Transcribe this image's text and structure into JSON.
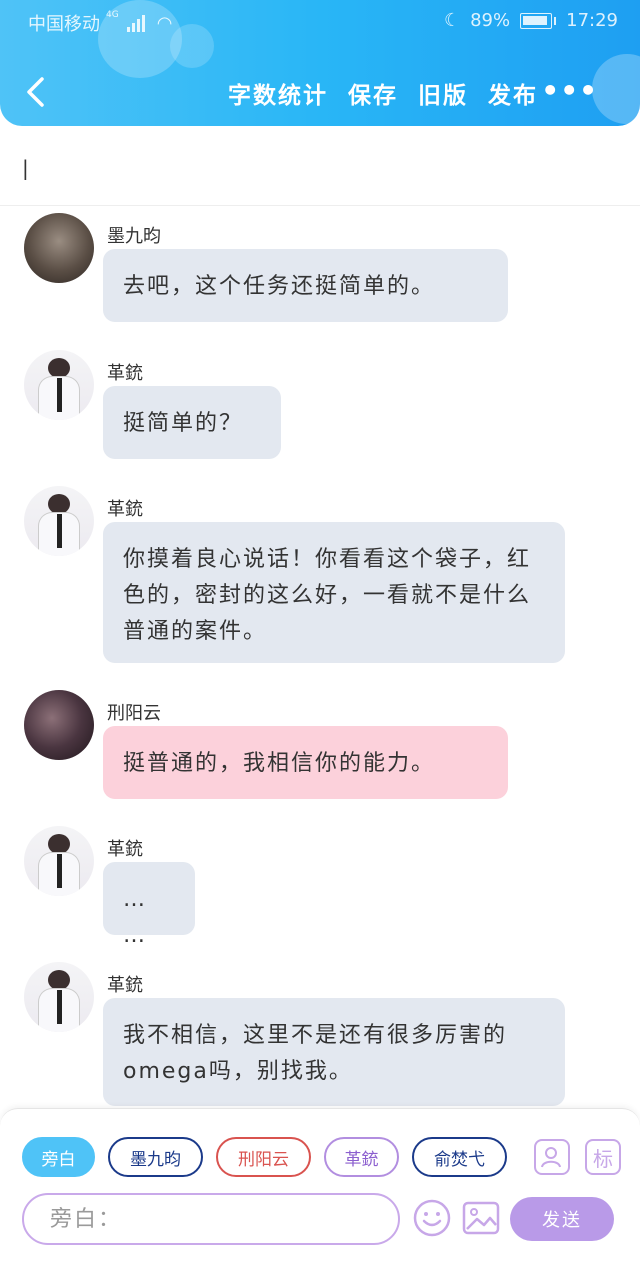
{
  "status_bar": {
    "carrier": "中国移动",
    "network": "4G",
    "battery": "89%",
    "time": "17:29"
  },
  "header": {
    "actions": [
      "字数统计",
      "保存",
      "旧版",
      "发布"
    ],
    "more": "•••"
  },
  "title_input": {
    "value": "|"
  },
  "messages": [
    {
      "sender": "墨九昀",
      "text": "去吧，这个任务还挺简单的。",
      "avatar": "mo",
      "style": "grey"
    },
    {
      "sender": "革銃",
      "text": "挺简单的？",
      "avatar": "ge",
      "style": "grey"
    },
    {
      "sender": "革銃",
      "text": "你摸着良心说话！你看看这个袋子，红色的，密封的这么好，一看就不是什么普通的案件。",
      "avatar": "ge",
      "style": "grey"
    },
    {
      "sender": "刑阳云",
      "text": "挺普通的，我相信你的能力。",
      "avatar": "xing",
      "style": "pink"
    },
    {
      "sender": "革銃",
      "text": "… …",
      "avatar": "ge",
      "style": "grey"
    },
    {
      "sender": "革銃",
      "text": "我不相信，这里不是还有很多厉害的omega吗，别找我。",
      "avatar": "ge",
      "style": "grey"
    }
  ],
  "composer": {
    "chips": [
      "旁白",
      "墨九昀",
      "刑阳云",
      "革銃",
      "俞焚弋"
    ],
    "tag_icon_label": "标",
    "input_placeholder": "旁白：",
    "send_label": "发送"
  },
  "colors": {
    "header_gradient": [
      "#4fc3f7",
      "#1e9ff2"
    ],
    "bubble_grey": "#e3e8f0",
    "bubble_pink": "#fcd1db",
    "accent_purple": "#b99ae8"
  }
}
